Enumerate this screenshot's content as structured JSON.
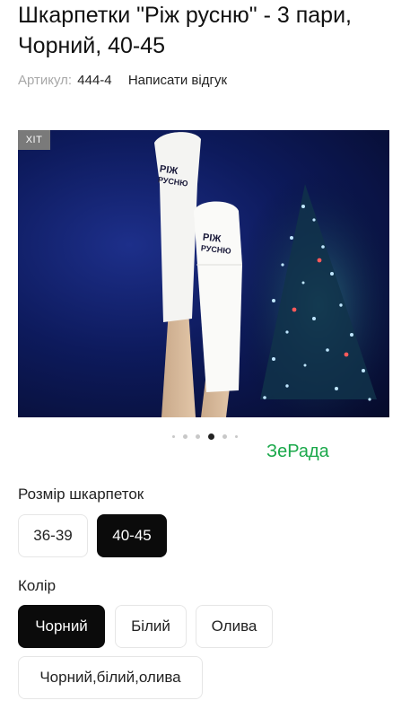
{
  "product": {
    "title": "Шкарпетки \"Ріж русню\" - 3 пари, Чорний, 40-45",
    "sku_label": "Артикул:",
    "sku_value": "444-4",
    "review_link": "Написати відгук"
  },
  "gallery": {
    "badge": "ХІТ",
    "slide_count": 6,
    "active_slide": 4,
    "sock_print_top": "РІЖ",
    "sock_print_bottom": "РУСНЮ",
    "watermark": "ЗеРада"
  },
  "size_section": {
    "label": "Розмір шкарпеток",
    "options": [
      {
        "label": "36-39",
        "selected": false
      },
      {
        "label": "40-45",
        "selected": true
      }
    ]
  },
  "color_section": {
    "label": "Колір",
    "options": [
      {
        "label": "Чорний",
        "selected": true
      },
      {
        "label": "Білий",
        "selected": false
      },
      {
        "label": "Олива",
        "selected": false
      },
      {
        "label": "Чорний,білий,олива",
        "selected": false
      }
    ]
  },
  "colors": {
    "selected_bg": "#0b0b0b",
    "watermark": "#1aa84a",
    "badge_bg": "#7a7a7a"
  }
}
